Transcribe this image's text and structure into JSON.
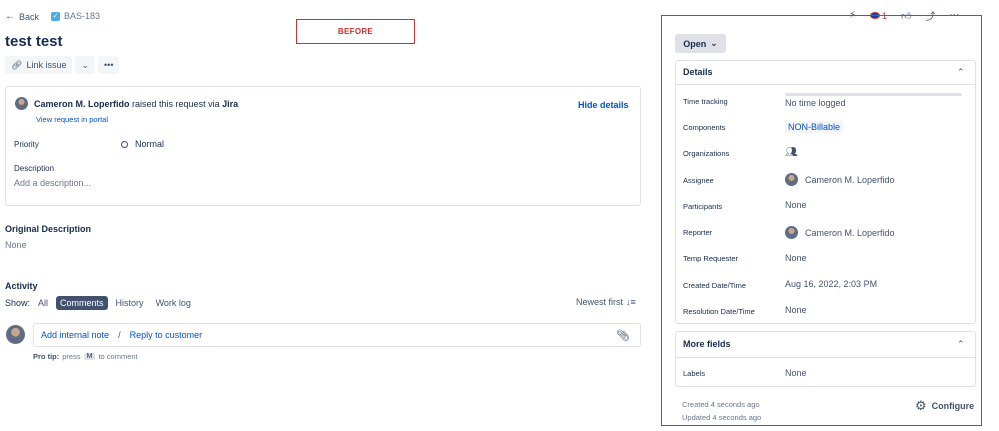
{
  "nav": {
    "back_label": "Back",
    "issue_key": "BAS-183"
  },
  "issue": {
    "title": "test test"
  },
  "toolbar": {
    "link_issue": "Link issue",
    "more": "•••",
    "dropdown": "⌄"
  },
  "annotation": {
    "before_label": "BEFORE"
  },
  "request": {
    "reporter_name": "Cameron M. Loperfido",
    "raised_text": "raised this request via",
    "channel": "Jira",
    "view_portal": "View request in portal",
    "hide_details": "Hide details",
    "priority_label": "Priority",
    "priority_value": "Normal",
    "description_label": "Description",
    "description_placeholder": "Add a description..."
  },
  "original_description": {
    "label": "Original Description",
    "value": "None"
  },
  "activity": {
    "heading": "Activity",
    "show_label": "Show:",
    "filters": [
      "All",
      "Comments",
      "History",
      "Work log"
    ],
    "active_filter": "Comments",
    "sort_label": "Newest first",
    "add_internal_note": "Add internal note",
    "separator": "/",
    "reply_to_customer": "Reply to customer",
    "protip_label": "Pro tip:",
    "protip_press": "press",
    "protip_key": "M",
    "protip_rest": "to comment"
  },
  "panel": {
    "watch_count": "1",
    "status": "Open",
    "details_heading": "Details",
    "fields": [
      {
        "label": "Time tracking",
        "value": "No time logged"
      },
      {
        "label": "Components",
        "value": "NON-Billable"
      },
      {
        "label": "Organizations",
        "value": ""
      },
      {
        "label": "Assignee",
        "value": "Cameron M. Loperfido"
      },
      {
        "label": "Participants",
        "value": "None"
      },
      {
        "label": "Reporter",
        "value": "Cameron M. Loperfido"
      },
      {
        "label": "Temp Requester",
        "value": "None"
      },
      {
        "label": "Created Date/Time",
        "value": "Aug 16, 2022, 2:03 PM"
      },
      {
        "label": "Resolution Date/Time",
        "value": "None"
      }
    ],
    "more_fields_heading": "More fields",
    "labels_label": "Labels",
    "labels_value": "None",
    "created": "Created 4 seconds ago",
    "updated": "Updated 4 seconds ago",
    "configure": "Configure"
  },
  "colors": {
    "accent": "#0052cc",
    "annotation_red": "#d0312d",
    "active_chip": "#42526e"
  }
}
